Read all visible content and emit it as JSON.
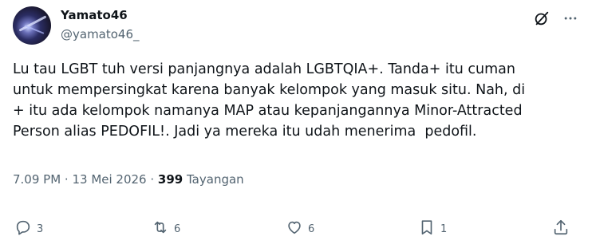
{
  "user": {
    "display_name": "Yamato46",
    "handle": "@yamato46_"
  },
  "icons": {
    "grok": "grok-icon",
    "more": "more-icon",
    "reply": "reply-icon",
    "retweet": "retweet-icon",
    "like": "heart-icon",
    "bookmark": "bookmark-icon",
    "share": "share-icon"
  },
  "tweet": {
    "text": "Lu tau LGBT tuh versi panjangnya adalah LGBTQIA+. Tanda+ itu cuman\nuntuk mempersingkat karena banyak kelompok yang masuk situ. Nah, di\n+ itu ada kelompok namanya MAP atau kepanjangannya Minor-Attracted\nPerson alias PEDOFIL!. Jadi ya mereka itu udah menerima  pedofil.",
    "timestamp": "7.09 PM · 13 Mei 2026",
    "separator": " · ",
    "views_count": "399",
    "views_label": "Tayangan"
  },
  "actions": {
    "reply_count": "3",
    "retweet_count": "6",
    "like_count": "6",
    "bookmark_count": "1"
  },
  "colors": {
    "text_primary": "#0f1419",
    "text_secondary": "#536471"
  }
}
